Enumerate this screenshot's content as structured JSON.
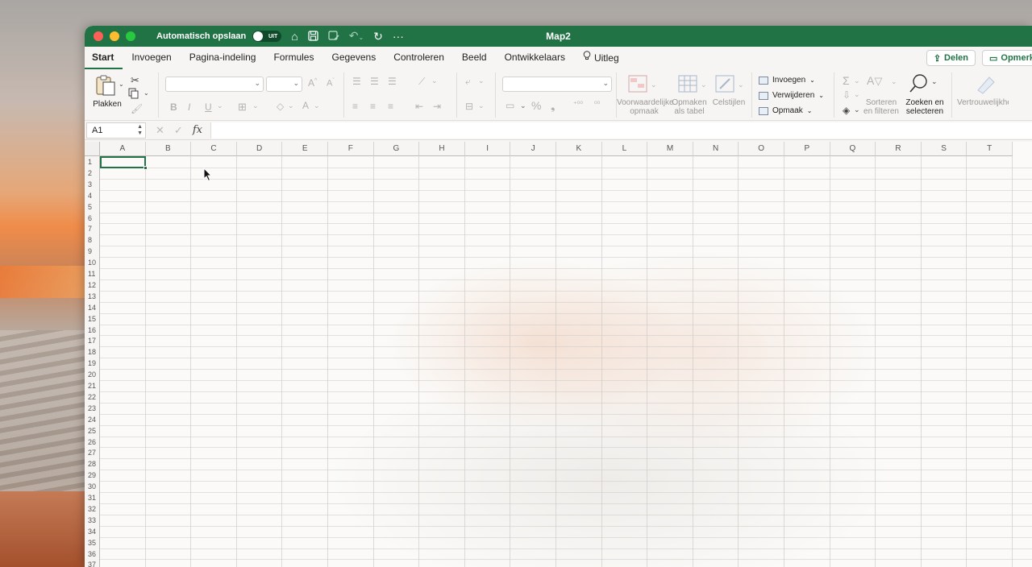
{
  "window": {
    "title": "Map2",
    "autosave_label": "Automatisch opslaan",
    "autosave_state": "UIT"
  },
  "tabs": [
    "Start",
    "Invoegen",
    "Pagina-indeling",
    "Formules",
    "Gegevens",
    "Controleren",
    "Beeld",
    "Ontwikkelaars",
    "Uitleg"
  ],
  "actions": {
    "share": "Delen",
    "comments": "Opmerkingen"
  },
  "ribbon": {
    "paste": "Plakken",
    "conditional_formatting": [
      "Voorwaardelijke",
      "opmaak"
    ],
    "format_as_table": [
      "Opmaken",
      "als tabel"
    ],
    "cell_styles": "Celstijlen",
    "insert": "Invoegen",
    "delete": "Verwijderen",
    "format": "Opmaak",
    "sort_filter": [
      "Sorteren",
      "en filteren"
    ],
    "find_select": [
      "Zoeken en",
      "selecteren"
    ],
    "sensitivity": "Vertrouwelijkheid",
    "bold": "B",
    "italic": "I",
    "underline": "U",
    "percent": "%",
    "comma": "❟"
  },
  "formula_bar": {
    "name_box": "A1",
    "fx": "fx"
  },
  "sheet": {
    "columns": [
      "A",
      "B",
      "C",
      "D",
      "E",
      "F",
      "G",
      "H",
      "I",
      "J",
      "K",
      "L",
      "M",
      "N",
      "O",
      "P",
      "Q",
      "R",
      "S",
      "T"
    ],
    "rows": [
      "1",
      "2",
      "3",
      "4",
      "5",
      "6",
      "7",
      "8",
      "9",
      "10",
      "11",
      "12",
      "13",
      "14",
      "15",
      "16",
      "17",
      "18",
      "19",
      "20",
      "21",
      "22",
      "23",
      "24",
      "25",
      "26",
      "27",
      "28",
      "29",
      "30",
      "31",
      "32",
      "33",
      "34",
      "35",
      "36",
      "37"
    ],
    "selected_cell": "A1"
  }
}
